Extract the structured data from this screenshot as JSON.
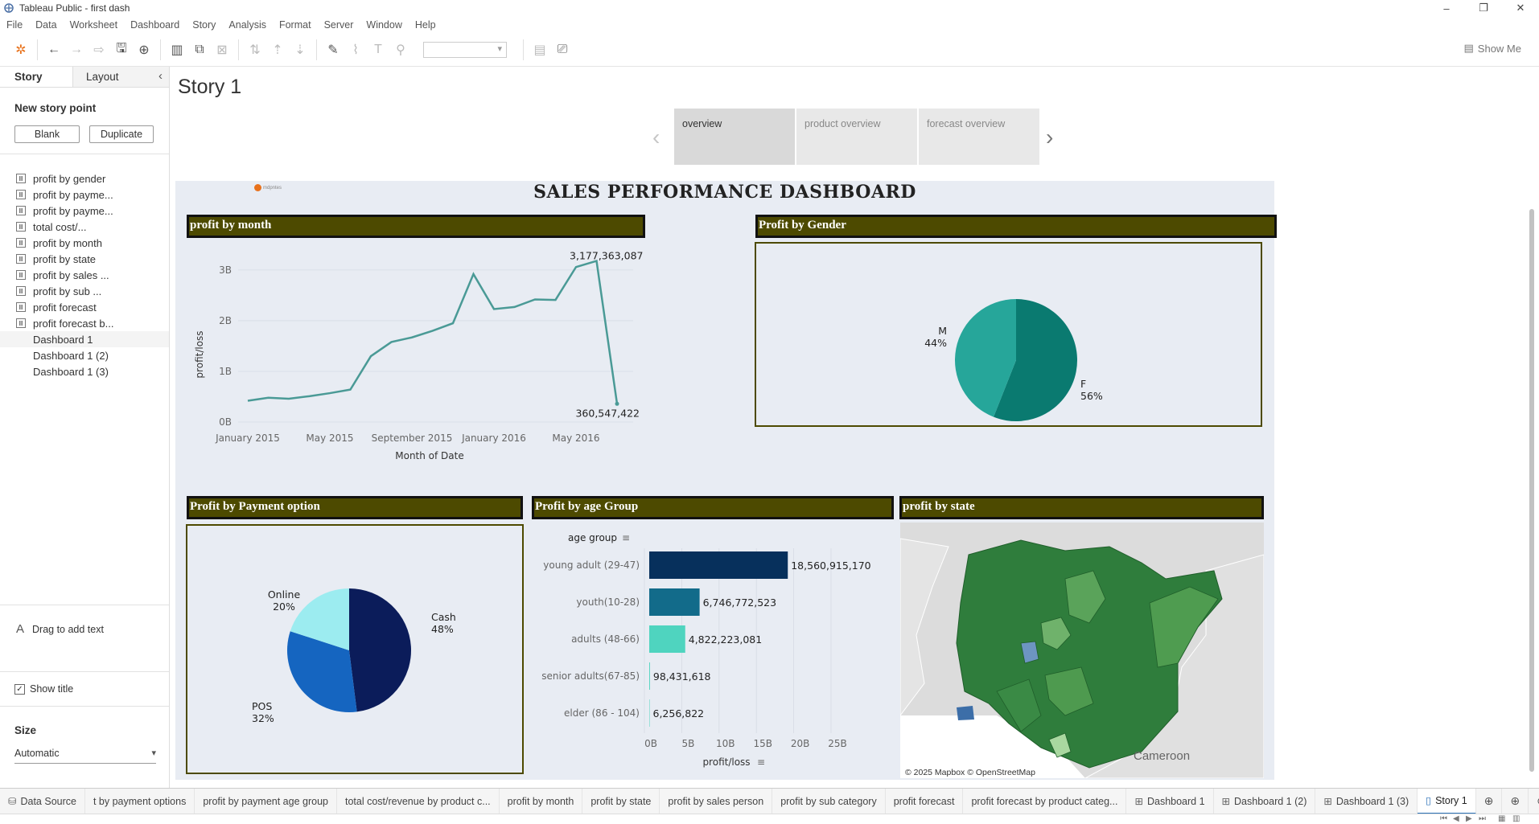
{
  "window": {
    "title": "Tableau Public - first dash"
  },
  "menu": [
    "File",
    "Data",
    "Worksheet",
    "Dashboard",
    "Story",
    "Analysis",
    "Format",
    "Server",
    "Window",
    "Help"
  ],
  "toolbar": {
    "show_me": "Show Me"
  },
  "sidebar": {
    "tabs": {
      "story": "Story",
      "layout": "Layout"
    },
    "new_story_point": "New story point",
    "blank_button": "Blank",
    "duplicate_button": "Duplicate",
    "sheets": [
      {
        "label": "profit by gender",
        "kind": "sheet"
      },
      {
        "label": "profit by payme...",
        "kind": "sheet"
      },
      {
        "label": "profit by payme...",
        "kind": "sheet"
      },
      {
        "label": "total cost/...",
        "kind": "sheet"
      },
      {
        "label": "profit by month",
        "kind": "sheet"
      },
      {
        "label": "profit by state",
        "kind": "sheet"
      },
      {
        "label": "profit by sales ...",
        "kind": "sheet"
      },
      {
        "label": "profit by sub ...",
        "kind": "sheet"
      },
      {
        "label": "profit forecast",
        "kind": "sheet"
      },
      {
        "label": "profit forecast b...",
        "kind": "sheet"
      },
      {
        "label": "Dashboard 1",
        "kind": "dashboard"
      },
      {
        "label": "Dashboard 1 (2)",
        "kind": "dashboard"
      },
      {
        "label": "Dashboard 1 (3)",
        "kind": "dashboard"
      }
    ],
    "drag_text": "Drag to add text",
    "show_title": "Show title",
    "size_label": "Size",
    "size_value": "Automatic"
  },
  "story": {
    "title": "Story 1",
    "points": [
      "overview",
      "product overview",
      "forecast overview"
    ],
    "active_point": 0
  },
  "dashboard": {
    "title": "SALES PERFORMANCE DASHBOARD",
    "logo_text": "mdpntes",
    "headers": {
      "month": "profit by month",
      "gender": "Profit by Gender",
      "payment": "Profit by Payment option",
      "age": "Profit by age Group",
      "state": "profit by state"
    },
    "map_attribution": "© 2025 Mapbox © OpenStreetMap",
    "map_label": "Cameroon"
  },
  "chart_data": [
    {
      "type": "line",
      "name": "profit by month",
      "xlabel": "Month of Date",
      "ylabel": "profit/loss",
      "x_tick_labels": [
        "January 2015",
        "May 2015",
        "September 2015",
        "January 2016",
        "May 2016"
      ],
      "y_tick_labels": [
        "0B",
        "1B",
        "2B",
        "3B"
      ],
      "ylim": [
        0,
        3.3
      ],
      "x": [
        "2015-01",
        "2015-02",
        "2015-03",
        "2015-04",
        "2015-05",
        "2015-06",
        "2015-07",
        "2015-08",
        "2015-09",
        "2015-10",
        "2015-11",
        "2015-12",
        "2016-01",
        "2016-02",
        "2016-03",
        "2016-04",
        "2016-05",
        "2016-06",
        "2016-07"
      ],
      "values_billions": [
        0.42,
        0.48,
        0.46,
        0.51,
        0.57,
        0.64,
        1.3,
        1.58,
        1.67,
        1.8,
        1.95,
        2.92,
        2.23,
        2.27,
        2.42,
        2.41,
        3.06,
        3.18,
        0.36
      ],
      "labels": {
        "max": "3,177,363,087",
        "last": "360,547,422"
      }
    },
    {
      "type": "pie",
      "name": "Profit by Gender",
      "slices": [
        {
          "label": "M",
          "pct": "44%",
          "value": 44,
          "color": "#26a69a"
        },
        {
          "label": "F",
          "pct": "56%",
          "value": 56,
          "color": "#0a7a70"
        }
      ]
    },
    {
      "type": "pie",
      "name": "Profit by Payment option",
      "slices": [
        {
          "label": "Cash",
          "pct": "48%",
          "value": 48,
          "color": "#0b1c5a"
        },
        {
          "label": "POS",
          "pct": "32%",
          "value": 32,
          "color": "#1565c0"
        },
        {
          "label": "Online",
          "pct": "20%",
          "value": 20,
          "color": "#9cecf0"
        }
      ]
    },
    {
      "type": "bar",
      "orientation": "horizontal",
      "name": "Profit by age Group",
      "dimension_label": "age group",
      "xlabel": "profit/loss",
      "x_tick_labels": [
        "0B",
        "5B",
        "10B",
        "15B",
        "20B",
        "25B"
      ],
      "xlim": [
        0,
        25
      ],
      "categories": [
        "young adult (29-47)",
        "youth(10-28)",
        "adults (48-66)",
        "senior adults(67-85)",
        "elder (86 - 104)"
      ],
      "values_billions": [
        18.56091517,
        6.746772523,
        4.822223081,
        0.098431618,
        0.006256822
      ],
      "value_labels": [
        "18,560,915,170",
        "6,746,772,523",
        "4,822,223,081",
        "98,431,618",
        "6,256,822"
      ],
      "colors": [
        "#07305c",
        "#126b8a",
        "#4fd4bf",
        "#4fd4bf",
        "#4fd4bf"
      ]
    }
  ],
  "bottom_tabs": [
    "Data Source",
    "t by payment options",
    "profit by payment age group",
    "total cost/revenue by product c...",
    "profit by month",
    "profit by state",
    "profit by sales person",
    "profit by sub category",
    "profit forecast",
    "profit forecast by product categ...",
    "Dashboard 1",
    "Dashboard 1 (2)",
    "Dashboard 1 (3)",
    "Story 1"
  ],
  "active_bottom_tab": "Story 1"
}
